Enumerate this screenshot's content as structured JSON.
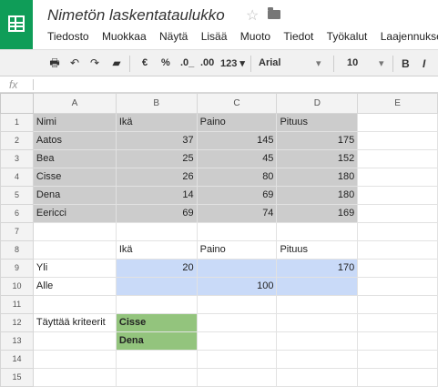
{
  "app": {
    "doc_title": "Nimetön laskentataulukko"
  },
  "menu": [
    "Tiedosto",
    "Muokkaa",
    "Näytä",
    "Lisää",
    "Muoto",
    "Tiedot",
    "Työkalut",
    "Laajennukset"
  ],
  "toolbar": {
    "currency": "€",
    "percent": "%",
    "dec_less": ".0_",
    "dec_more": ".00",
    "more_formats": "123 ▾",
    "font": "Arial",
    "font_size": "10",
    "bold": "B",
    "italic": "I"
  },
  "formula_bar": {
    "fx": "fx",
    "value": ""
  },
  "columns": [
    "A",
    "B",
    "C",
    "D",
    "E"
  ],
  "rows": [
    {
      "n": "1",
      "cells": [
        "Nimi",
        "Ikä",
        "Paino",
        "Pituus",
        ""
      ]
    },
    {
      "n": "2",
      "cells": [
        "Aatos",
        "37",
        "145",
        "175",
        ""
      ]
    },
    {
      "n": "3",
      "cells": [
        "Bea",
        "25",
        "45",
        "152",
        ""
      ]
    },
    {
      "n": "4",
      "cells": [
        "Cisse",
        "26",
        "80",
        "180",
        ""
      ]
    },
    {
      "n": "5",
      "cells": [
        "Dena",
        "14",
        "69",
        "180",
        ""
      ]
    },
    {
      "n": "6",
      "cells": [
        "Eericci",
        "69",
        "74",
        "169",
        ""
      ]
    },
    {
      "n": "7",
      "cells": [
        "",
        "",
        "",
        "",
        ""
      ]
    },
    {
      "n": "8",
      "cells": [
        "",
        "Ikä",
        "Paino",
        "Pituus",
        ""
      ]
    },
    {
      "n": "9",
      "cells": [
        "Yli",
        "20",
        "",
        "170",
        ""
      ]
    },
    {
      "n": "10",
      "cells": [
        "Alle",
        "",
        "100",
        "",
        ""
      ]
    },
    {
      "n": "11",
      "cells": [
        "",
        "",
        "",
        "",
        ""
      ]
    },
    {
      "n": "12",
      "cells": [
        "Täyttää kriteerit",
        "Cisse",
        "",
        "",
        ""
      ]
    },
    {
      "n": "13",
      "cells": [
        "",
        "Dena",
        "",
        "",
        ""
      ]
    },
    {
      "n": "14",
      "cells": [
        "",
        "",
        "",
        "",
        ""
      ]
    },
    {
      "n": "15",
      "cells": [
        "",
        "",
        "",
        "",
        ""
      ]
    }
  ]
}
